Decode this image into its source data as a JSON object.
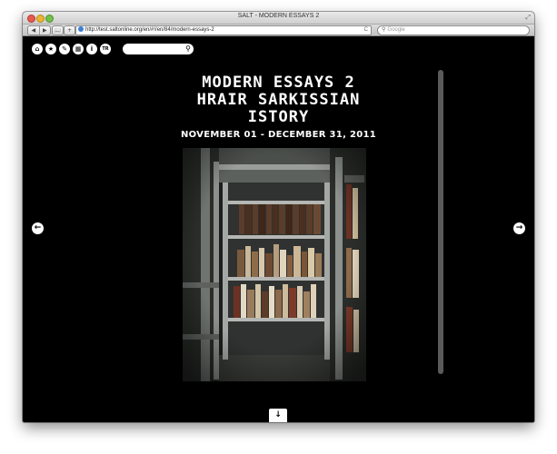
{
  "window": {
    "title": "SALT - MODERN ESSAYS 2",
    "url": "http://test.saltonline.org/en/#!/en/84/modern-essays-2",
    "search_placeholder": "Google",
    "nav_back": "◀",
    "nav_forward": "▶",
    "add_tab": "+",
    "bookmarks": "📖",
    "reload": "C",
    "resize": "⤢"
  },
  "site": {
    "icons": [
      {
        "name": "home-icon",
        "glyph": "⌂"
      },
      {
        "name": "star-icon",
        "glyph": "★"
      },
      {
        "name": "tag-icon",
        "glyph": "✎"
      },
      {
        "name": "calendar-icon",
        "glyph": "▦"
      },
      {
        "name": "info-icon",
        "glyph": "i"
      },
      {
        "name": "language-tr-icon",
        "glyph": "TR"
      }
    ],
    "search_glyph": "⚲",
    "title_line1": "MODERN ESSAYS 2",
    "title_line2": "HRAIR SARKISSIAN",
    "title_line3": "ISTORY",
    "dates": "NOVEMBER 01 - DECEMBER 31, 2011",
    "prev_glyph": "←",
    "next_glyph": "→",
    "down_glyph": "↓"
  },
  "colors": {
    "background": "#000000",
    "foreground": "#ffffff",
    "scrollbar": "#5a5a5a"
  }
}
